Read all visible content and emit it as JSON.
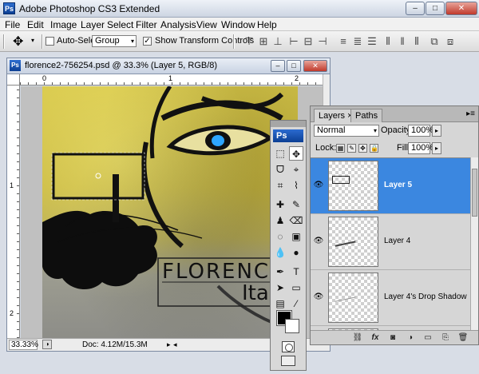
{
  "app": {
    "title": "Adobe Photoshop CS3 Extended",
    "logo_text": "Ps",
    "window_buttons": {
      "minimize": "–",
      "maximize": "□",
      "close": "✕"
    }
  },
  "menu": [
    "File",
    "Edit",
    "Image",
    "Layer",
    "Select",
    "Filter",
    "Analysis",
    "View",
    "Window",
    "Help"
  ],
  "options": {
    "auto_select_label": "Auto-Select:",
    "auto_select_checked": false,
    "auto_select_value": "Group",
    "show_transform_label": "Show Transform Controls",
    "show_transform_checked": true,
    "check_mark": "✓",
    "dropdown_glyph": "▾"
  },
  "document": {
    "title": "florence2-756254.psd @ 33.3% (Layer 5, RGB/8)",
    "logo_text": "Ps",
    "ruler_h": [
      "0",
      "1",
      "2"
    ],
    "ruler_v": [
      "1",
      "2"
    ],
    "zoom": "33.33%",
    "doc_size": "Doc: 4.12M/15.3M",
    "text_florence": "FLORENC",
    "text_italy": "Ital"
  },
  "tools": {
    "logo_text": "Ps",
    "items": [
      [
        "⬚",
        "✥"
      ],
      [
        "ᗜ",
        "⌖"
      ],
      [
        "⌗",
        "⌇"
      ],
      [
        "✚",
        "✎"
      ],
      [
        "♟",
        "⌫"
      ],
      [
        "◌",
        "▣"
      ],
      [
        "💧",
        "●"
      ],
      [
        "✒",
        "T"
      ],
      [
        "➤",
        "▭"
      ],
      [
        "▤",
        "⁄"
      ],
      [
        "✋",
        "🔍"
      ]
    ]
  },
  "layers_panel": {
    "tabs": [
      "Layers",
      "Paths"
    ],
    "tab_close": "×",
    "menu_glyph": "▸≡",
    "blend_mode": "Normal",
    "opacity_label": "Opacity:",
    "opacity": "100%",
    "lock_label": "Lock:",
    "fill_label": "Fill:",
    "fill": "100%",
    "eye_glyph": "👁",
    "layers": [
      {
        "name": "Layer 5",
        "visible": true,
        "selected": true
      },
      {
        "name": "Layer 4",
        "visible": true,
        "selected": false
      },
      {
        "name": "Layer 4's Drop Shadow",
        "visible": true,
        "selected": false
      },
      {
        "name": "",
        "visible": false,
        "selected": false
      }
    ],
    "footer_icons": [
      "⛓",
      "fx",
      "◙",
      "◑",
      "▭",
      "⎘",
      "🗑"
    ]
  },
  "colors": {
    "selection_blue": "#3b87e0",
    "title_blue": "#0c3f94",
    "eye_iris": "#2ea6ff"
  }
}
